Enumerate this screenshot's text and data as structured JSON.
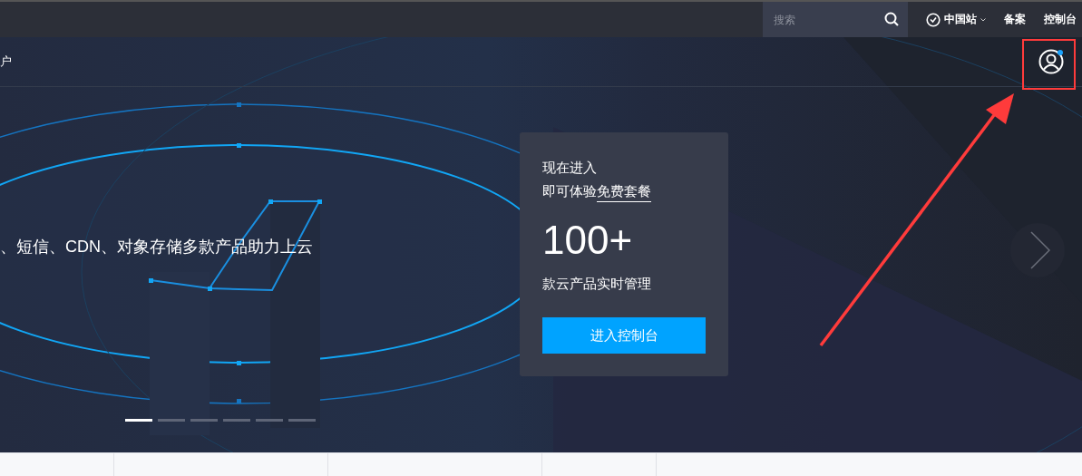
{
  "top_bar": {
    "search": {
      "placeholder": "搜索"
    },
    "region": "中国站",
    "links": [
      "备案",
      "控制台"
    ]
  },
  "sub_nav": {
    "item": "户",
    "user": {
      "has_notification": true
    }
  },
  "hero": {
    "subtitle": "、短信、CDN、对象存储多款产品助力上云",
    "card": {
      "line_1": "现在进入",
      "line_2_prefix": "即可体验",
      "line_2_link": "免费套餐",
      "count": "100+",
      "caption": "款云产品实时管理",
      "button": "进入控制台"
    },
    "slides": [
      {
        "selected": true
      },
      {
        "selected": false
      },
      {
        "selected": false
      },
      {
        "selected": false
      },
      {
        "selected": false
      },
      {
        "selected": false
      }
    ]
  }
}
